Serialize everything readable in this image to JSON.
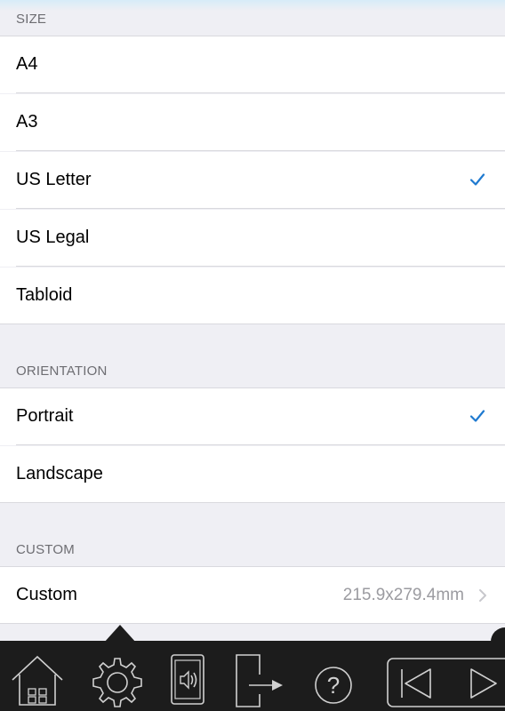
{
  "sections": {
    "size": {
      "header": "SIZE",
      "items": [
        {
          "label": "A4",
          "checked": false
        },
        {
          "label": "A3",
          "checked": false
        },
        {
          "label": "US Letter",
          "checked": true
        },
        {
          "label": "US Legal",
          "checked": false
        },
        {
          "label": "Tabloid",
          "checked": false
        }
      ]
    },
    "orientation": {
      "header": "ORIENTATION",
      "items": [
        {
          "label": "Portrait",
          "checked": true
        },
        {
          "label": "Landscape",
          "checked": false
        }
      ]
    },
    "custom": {
      "header": "CUSTOM",
      "items": [
        {
          "label": "Custom",
          "value": "215.9x279.4mm"
        }
      ]
    }
  },
  "toolbar": {
    "items": [
      "home-icon",
      "settings-gear-icon",
      "tablet-sound-icon",
      "export-icon",
      "help-icon",
      "first-page-icon",
      "next-page-icon"
    ]
  },
  "colors": {
    "accent": "#1f7ad0",
    "background": "#efeff4",
    "toolbar": "#1c1c1c"
  }
}
